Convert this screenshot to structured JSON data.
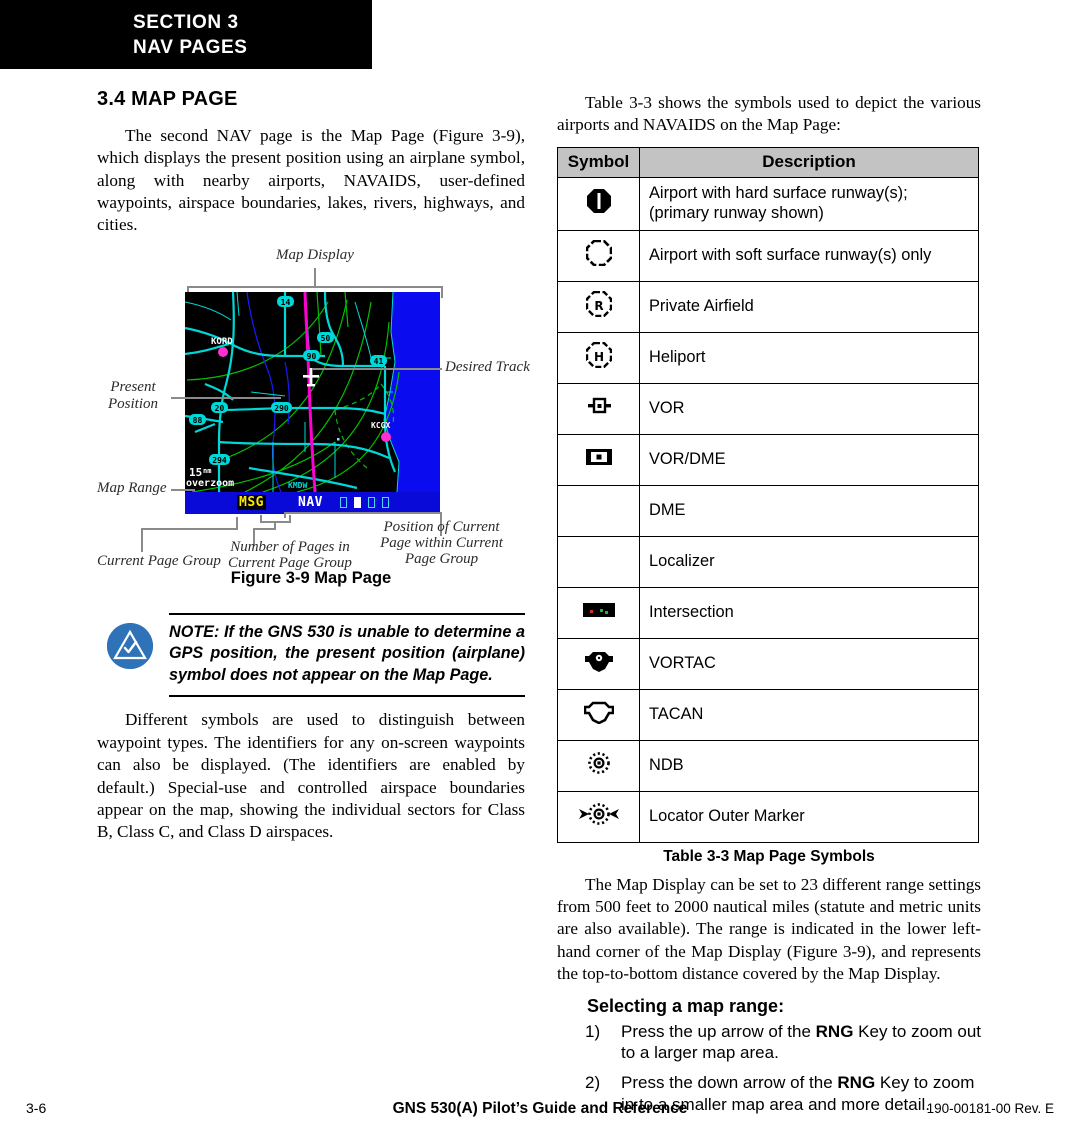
{
  "header": {
    "section_line1": "SECTION 3",
    "section_line2": "NAV PAGES"
  },
  "left_column": {
    "section_number_title": "3.4  MAP PAGE",
    "intro_paragraph": "The second NAV page is the Map Page (Figure 3-9), which displays the present position using an airplane symbol, along with nearby airports, NAVAIDS, user-defined waypoints, airspace boundaries, lakes, rivers, highways, and cities.",
    "closing_paragraph": "Different symbols are used to distinguish between waypoint types.  The identifiers for any on-screen waypoints can also be displayed.  (The identifiers are enabled by default.)  Special-use and controlled airspace boundaries appear on the map, showing the individual sectors for Class B, Class C, and Class D airspaces."
  },
  "figure": {
    "caption": "Figure 3-9  Map Page",
    "callouts": {
      "map_display": "Map Display",
      "desired_track": "Desired Track",
      "present_position_l1": "Present",
      "present_position_l2": "Position",
      "map_range": "Map Range",
      "current_page_group": "Current Page Group",
      "number_of_pages_l1": "Number of Pages in",
      "number_of_pages_l2": "Current Page Group",
      "page_position_l1": "Position of Current",
      "page_position_l2": "Page within Current",
      "page_position_l3": "Page Group"
    },
    "map_display_values": {
      "range": "15",
      "range_unit": "nm",
      "overzoom": "overzoom",
      "message_annunciator": "MSG",
      "page_group": "NAV",
      "airport_label_1": "KORD",
      "airport_label_2": "KCGX",
      "highway_labels": [
        "14",
        "50",
        "90",
        "41",
        "20",
        "290",
        "88",
        "294"
      ],
      "page_dots_total": 4,
      "page_dots_active_index": 1
    }
  },
  "note": {
    "icon": "note-triangle-check-icon",
    "text": "NOTE:  If the GNS 530 is unable to determine a GPS position, the present position (airplane) symbol does not appear on the Map Page.",
    "icon_color": "#2f72b8"
  },
  "right_column": {
    "table_intro": "Table 3-3 shows the symbols used to depict the various airports and NAVAIDS on the Map Page:",
    "table_caption": "Table 3-3 Map Page Symbols",
    "range_paragraph": "The Map Display can be set to 23 different range settings from 500 feet to 2000 nautical miles (statute and metric units are also available).  The range is indicated in the lower left-hand corner of the Map Display (Figure 3-9), and represents the top-to-bottom distance covered by the Map Display.",
    "procedure_title": "Selecting a map range:",
    "steps": [
      {
        "num": "1)",
        "pre": "Press the up arrow of the ",
        "key": "RNG",
        "post": " Key to zoom out to a larger map area."
      },
      {
        "num": "2)",
        "pre": "Press the down arrow of the ",
        "key": "RNG",
        "post": " Key to zoom in to a smaller map area and more detail."
      }
    ]
  },
  "symbol_table": {
    "headers": [
      "Symbol",
      "Description"
    ],
    "header_bg": "#c3c3c3",
    "rows": [
      {
        "icon": "airport-hard-surface-icon",
        "description": "Airport with hard surface runway(s); (primary runway shown)"
      },
      {
        "icon": "airport-soft-surface-icon",
        "description": "Airport with soft surface runway(s) only"
      },
      {
        "icon": "private-airfield-icon",
        "description": "Private Airfield"
      },
      {
        "icon": "heliport-icon",
        "description": "Heliport"
      },
      {
        "icon": "vor-icon",
        "description": "VOR"
      },
      {
        "icon": "vor-dme-icon",
        "description": "VOR/DME"
      },
      {
        "icon": "",
        "description": "DME"
      },
      {
        "icon": "",
        "description": "Localizer"
      },
      {
        "icon": "intersection-icon",
        "description": "Intersection"
      },
      {
        "icon": "vortac-icon",
        "description": "VORTAC"
      },
      {
        "icon": "tacan-icon",
        "description": "TACAN"
      },
      {
        "icon": "ndb-icon",
        "description": "NDB"
      },
      {
        "icon": "locator-outer-marker-icon",
        "description": "Locator Outer Marker"
      }
    ]
  },
  "footer": {
    "page_number": "3-6",
    "title": "GNS 530(A) Pilot’s Guide and Reference",
    "part_number": "190-00181-00  Rev. E"
  }
}
